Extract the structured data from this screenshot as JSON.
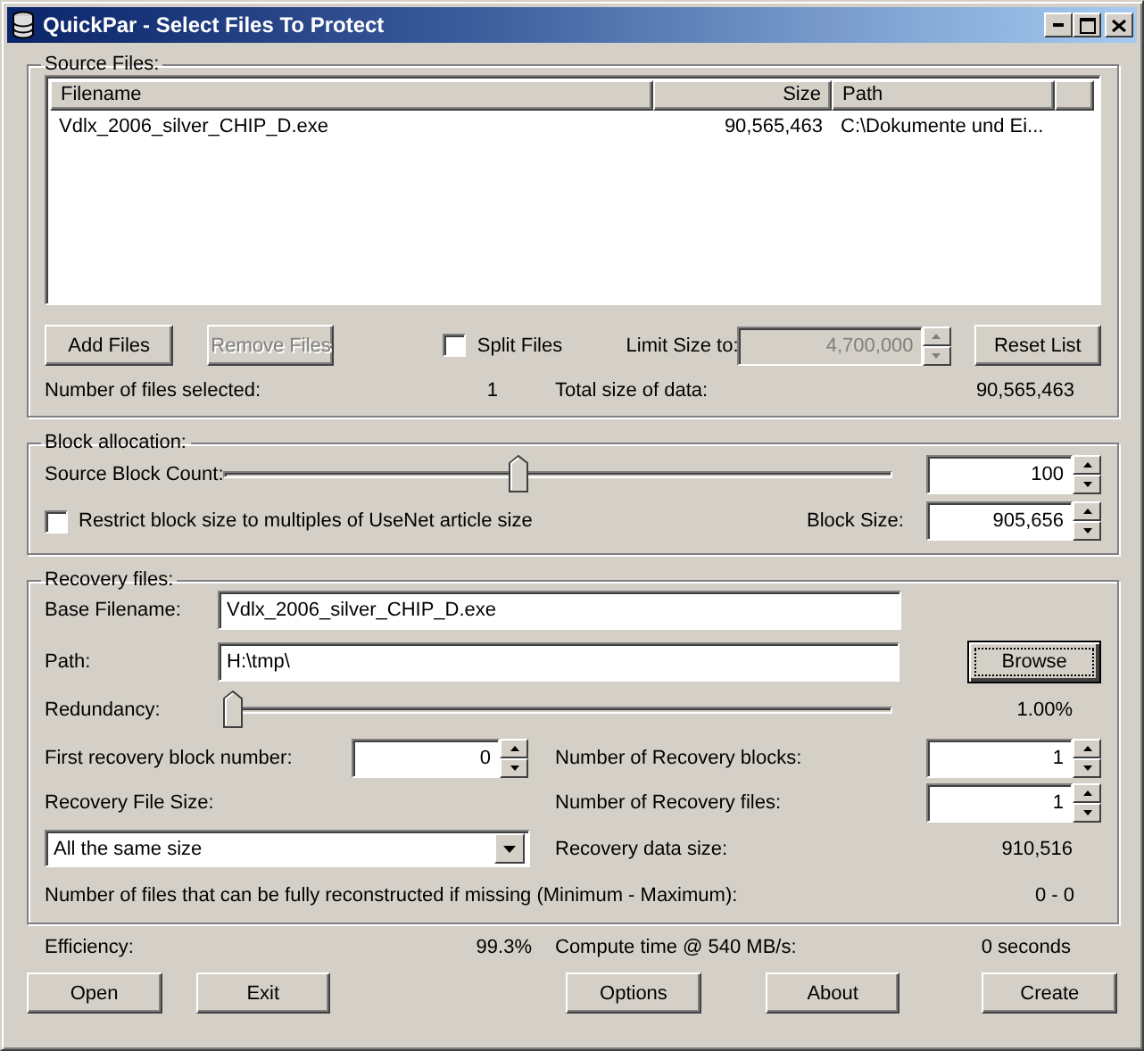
{
  "window": {
    "title": "QuickPar - Select Files To Protect"
  },
  "source_files": {
    "title": "Source Files:",
    "table": {
      "columns": [
        "Filename",
        "Size",
        "Path"
      ],
      "rows": [
        {
          "filename": "Vdlx_2006_silver_CHIP_D.exe",
          "size": "90,565,463",
          "path": "C:\\Dokumente und Ei...",
          "selected": false
        }
      ]
    },
    "buttons": [
      {
        "label": "Add Files",
        "disabled": false
      },
      {
        "label": "Remove Files",
        "disabled": true
      }
    ],
    "split_files": {
      "label": "Split Files",
      "checked": false
    },
    "limit_size": {
      "label": "Limit Size to:",
      "value": "4,700,000",
      "disabled": true
    },
    "reset_button": "Reset List",
    "files_selected": {
      "label": "Number of files selected:",
      "value": "1"
    },
    "total_size": {
      "label": "Total size of data:",
      "value": "90,565,463"
    }
  },
  "block_allocation": {
    "title": "Block allocation:",
    "source_block_count": {
      "label": "Source Block Count:",
      "level": 0.44,
      "value": "100"
    },
    "restrict": {
      "label": "Restrict block size to multiples of UseNet article size",
      "checked": false
    },
    "block_size": {
      "label": "Block Size:",
      "value": "905,656"
    }
  },
  "recovery_files": {
    "title": "Recovery files:",
    "base_filename": {
      "label": "Base Filename:",
      "value": "Vdlx_2006_silver_CHIP_D.exe"
    },
    "path": {
      "label": "Path:",
      "value": "H:\\tmp\\"
    },
    "browse_button": "Browse",
    "redundancy": {
      "label": "Redundancy:",
      "level": 0,
      "reading": "1.00%"
    },
    "first_block": {
      "label": "First recovery block number:",
      "value": "0"
    },
    "recovery_blocks": {
      "label": "Number of Recovery blocks:",
      "value": "1"
    },
    "file_size": {
      "label": "Recovery File Size:",
      "value": "All the same size"
    },
    "recovery_file_count": {
      "label": "Number of Recovery files:",
      "value": "1"
    },
    "data_size": {
      "label": "Recovery data size:",
      "value": "910,516"
    },
    "reconstructable": {
      "label": "Number of files that can be fully reconstructed if missing (Minimum - Maximum):",
      "value": "0 - 0"
    }
  },
  "efficiency": {
    "label": "Efficiency:",
    "value": "99.3%"
  },
  "compute_time": {
    "label": "Compute time @ 540 MB/s:",
    "value": "0 seconds"
  },
  "buttons": [
    "Open",
    "Exit",
    "Options",
    "About",
    "Create"
  ]
}
